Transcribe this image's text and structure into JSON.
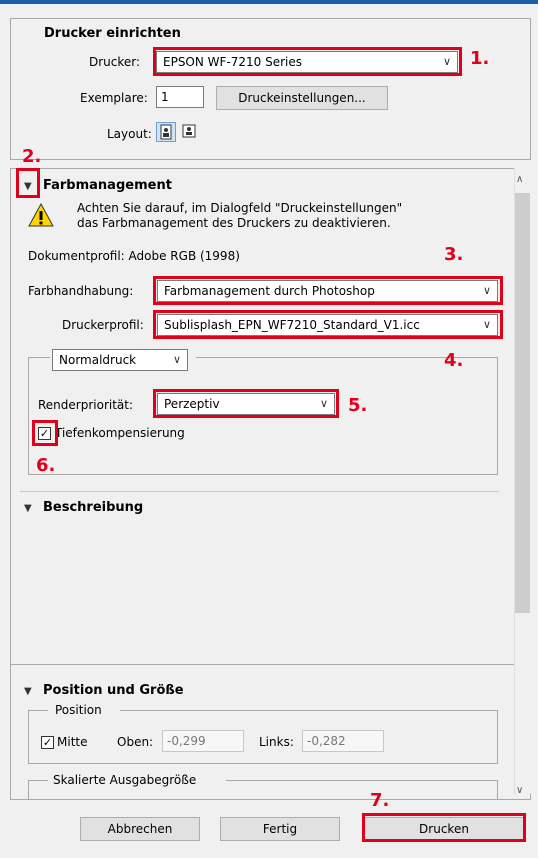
{
  "printer_setup": {
    "title": "Drucker einrichten",
    "printer_label": "Drucker:",
    "printer_value": "EPSON WF-7210 Series",
    "copies_label": "Exemplare:",
    "copies_value": "1",
    "print_settings_button": "Druckeinstellungen...",
    "layout_label": "Layout:"
  },
  "color_management": {
    "title": "Farbmanagement",
    "warning_line1": "Achten Sie darauf, im Dialogfeld \"Druckeinstellungen\"",
    "warning_line2": "das Farbmanagement des Druckers zu deaktivieren.",
    "document_profile": "Dokumentprofil: Adobe RGB (1998)",
    "color_handling_label": "Farbhandhabung:",
    "color_handling_value": "Farbmanagement durch Photoshop",
    "printer_profile_label": "Druckerprofil:",
    "printer_profile_value": "Sublisplash_EPN_WF7210_Standard_V1.icc",
    "print_mode_value": "Normaldruck",
    "render_priority_label": "Renderpriorität:",
    "render_priority_value": "Perzeptiv",
    "depth_compensation_label": "Tiefenkompensierung"
  },
  "description": {
    "title": "Beschreibung"
  },
  "position_size": {
    "title": "Position und Größe",
    "position_group": "Position",
    "center_label": "Mitte",
    "top_label": "Oben:",
    "top_value": "-0,299",
    "left_label": "Links:",
    "left_value": "-0,282",
    "scaled_group": "Skalierte Ausgabegröße"
  },
  "footer": {
    "cancel_button": "Abbrechen",
    "done_button": "Fertig",
    "print_button": "Drucken"
  },
  "annotations": {
    "step1": "1.",
    "step2": "2.",
    "step3": "3.",
    "step4": "4.",
    "step5": "5.",
    "step6": "6.",
    "step7": "7.",
    "color": "#e0001b"
  }
}
